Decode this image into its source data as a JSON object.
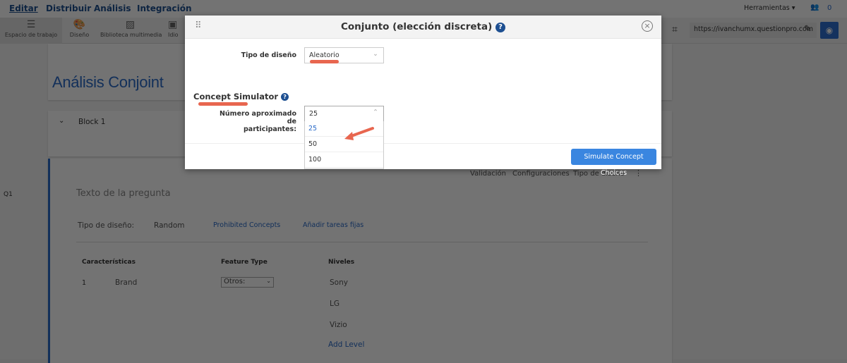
{
  "nav": {
    "items": [
      "Editar",
      "Distribuir",
      "Análisis",
      "Integración"
    ],
    "tools": "Herramientas",
    "users_count": "0"
  },
  "toolbar": {
    "items": [
      "Espacio de trabajo",
      "Diseño",
      "Biblioteca multimedia",
      "Idio"
    ],
    "url": "https://ivanchumx.questionpro.com"
  },
  "survey": {
    "title": "Análisis Conjoint",
    "block": "Block 1",
    "q_label": "Q1",
    "q_actions": [
      "Validación",
      "Configuraciones",
      "Tipo de diseño"
    ],
    "q_text": "Texto de la pregunta",
    "design_label": "Tipo de diseño:",
    "design_value": "Random",
    "prohibited": "Prohibited Concepts",
    "fixed_tasks": "Añadir tareas fijas",
    "columns": [
      "Características",
      "Feature Type",
      "Niveles"
    ],
    "row_num": "1",
    "row_name": "Brand",
    "feature_type": "Otros:",
    "levels": [
      "Sony",
      "LG",
      "Vizio"
    ],
    "add_level": "Add Level"
  },
  "modal": {
    "title": "Conjunto (elección discreta)",
    "design_label": "Tipo de diseño",
    "design_value": "Aleatorio",
    "section": "Concept Simulator",
    "participants_label_1": "Número aproximado de",
    "participants_label_2": "participantes:",
    "participants_value": "25",
    "options": [
      "25",
      "50",
      "100"
    ],
    "button": "Simulate Concept Choices"
  }
}
